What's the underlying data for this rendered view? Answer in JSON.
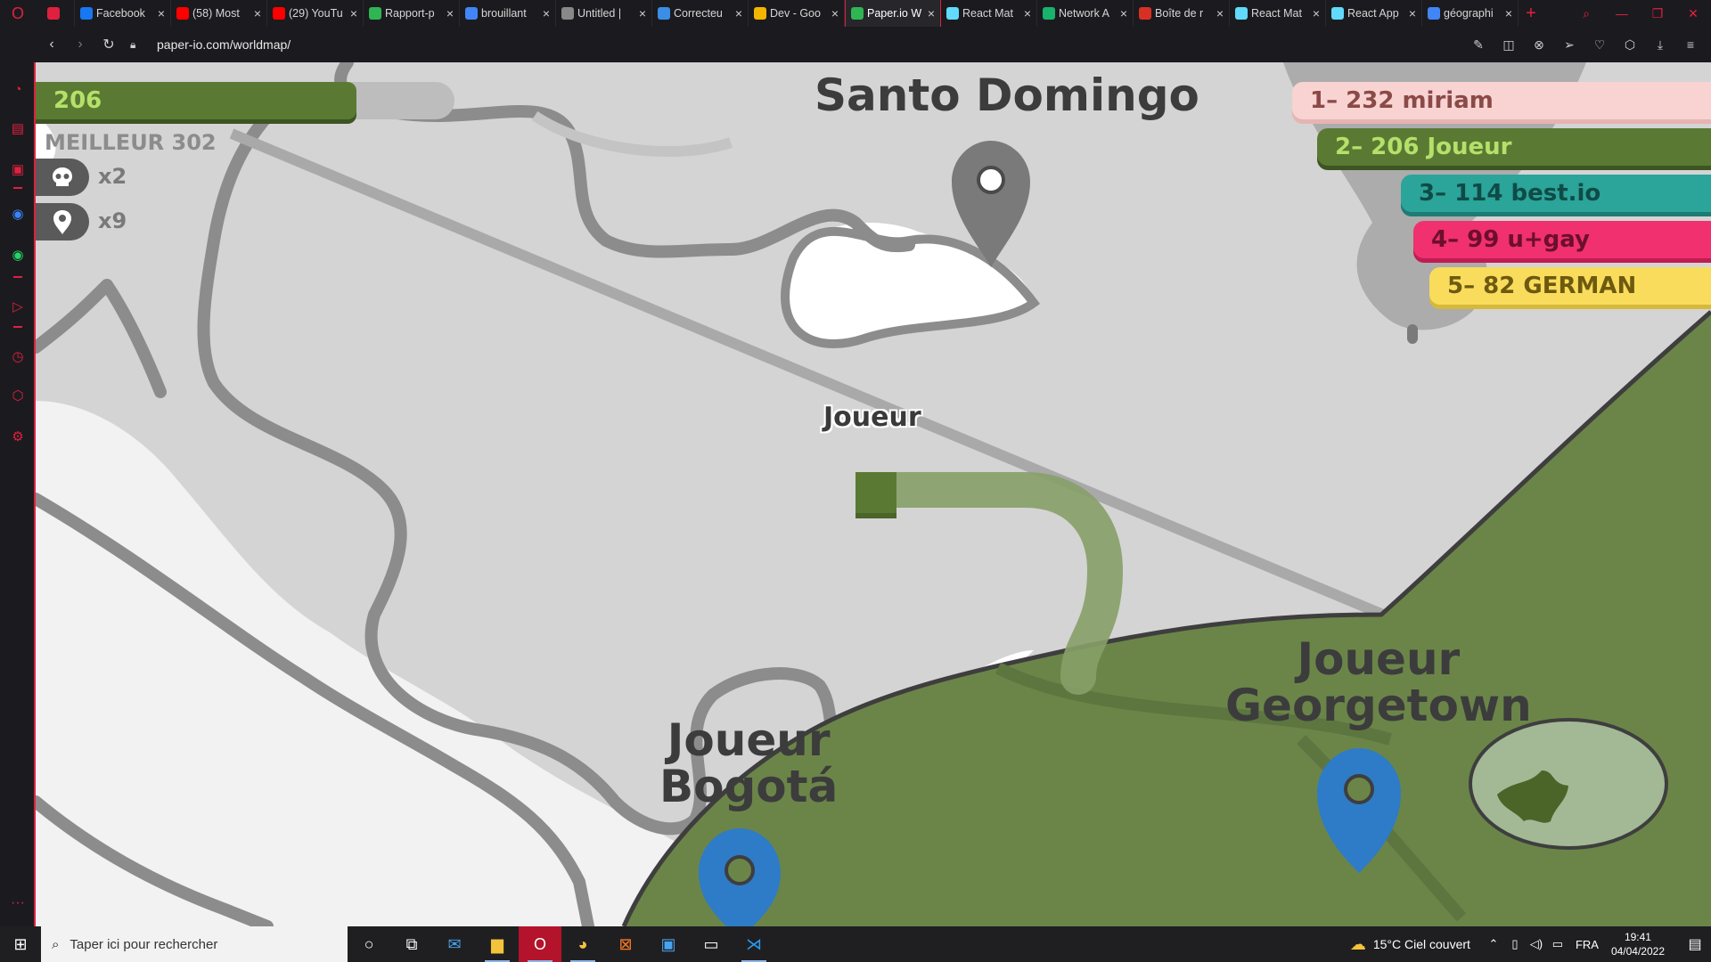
{
  "browser": {
    "tabs": [
      {
        "label": "",
        "icon": "messenger-icon",
        "color": "#e0203f"
      },
      {
        "label": "Facebook",
        "icon": "facebook-icon",
        "color": "#1877f2"
      },
      {
        "label": "(58) Most",
        "icon": "youtube-icon",
        "color": "#ff0000"
      },
      {
        "label": "(29) YouTu",
        "icon": "youtube-icon",
        "color": "#ff0000"
      },
      {
        "label": "Rapport-p",
        "icon": "leaf-icon",
        "color": "#2fb552"
      },
      {
        "label": "brouillant",
        "icon": "docs-icon",
        "color": "#4285f4"
      },
      {
        "label": "Untitled |",
        "icon": "globe-icon",
        "color": "#888888"
      },
      {
        "label": "Correcteu",
        "icon": "check-icon",
        "color": "#3a8ee6"
      },
      {
        "label": "Dev - Goo",
        "icon": "drive-icon",
        "color": "#f4b400"
      },
      {
        "label": "Paper.io W",
        "icon": "paperio-icon",
        "color": "#2fb552",
        "active": true
      },
      {
        "label": "React Mat",
        "icon": "react-icon",
        "color": "#61dafb"
      },
      {
        "label": "Network A",
        "icon": "network-icon",
        "color": "#19b36b"
      },
      {
        "label": "Boîte de r",
        "icon": "gmail-icon",
        "color": "#d93025"
      },
      {
        "label": "React Mat",
        "icon": "react-icon",
        "color": "#61dafb"
      },
      {
        "label": "React App",
        "icon": "react-icon",
        "color": "#61dafb"
      },
      {
        "label": "géographi",
        "icon": "google-icon",
        "color": "#4285f4"
      }
    ],
    "url": "paper-io.com/worldmap/"
  },
  "game": {
    "score": "206",
    "best": "MEILLEUR 302",
    "kills": "x2",
    "pins": "x9",
    "player_name": "Joueur",
    "cities": {
      "santo_domingo": "Santo Domingo",
      "bogota": "Joueur\nBogotá",
      "georgetown": "Joueur\nGeorgetown"
    },
    "leaderboard": [
      "1– 232 miriam",
      "2– 206 Joueur",
      "3– 114 best.io",
      "4– 99 u+gay",
      "5– 82 GERMAN"
    ],
    "colors": {
      "player_territory": "#6b8549",
      "player_trail": "#86a068",
      "player_head": "#4b6528",
      "map_pin_owned": "#2e7bc7",
      "map_pin_neutral": "#7a7a7a"
    }
  },
  "taskbar": {
    "search_placeholder": "Taper ici pour rechercher",
    "weather": "15°C  Ciel couvert",
    "lang": "FRA",
    "time": "19:41",
    "date": "04/04/2022"
  }
}
